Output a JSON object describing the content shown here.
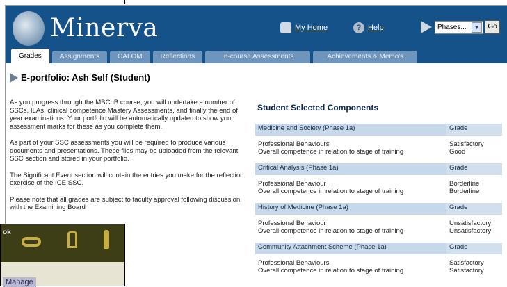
{
  "app": {
    "brand": "Minerva",
    "home_link": "My Home",
    "help_link": "Help",
    "help_glyph": "?",
    "phase_select_value": "Phases...",
    "phase_select_arrow": "▼",
    "go_label": "Go"
  },
  "tabs": [
    {
      "label": "Grades",
      "active": true
    },
    {
      "label": "Assignments",
      "active": false
    },
    {
      "label": "CALOM",
      "active": false
    },
    {
      "label": "Reflections",
      "active": false
    },
    {
      "label": "In-course Assessments",
      "active": false
    },
    {
      "label": "Achievements & Memo's",
      "active": false
    }
  ],
  "page": {
    "title": "E-portfolio: Ash Self (Student)",
    "intro": [
      "As you progress through the MBChB course, you will undertake a number of SSCs, ILAs, clinical competence Mastery Assessments, and finally the end of year examinations. Your portfolio will be automatically updated to show your assessment marks for these as you complete them.",
      "As part of your SSC assessments you will be required to produce various documents and presentations. These files may be uploaded from the relevant SSC section and stored in your portfolio.",
      "The Significant Event section will contain the entries you make for the reflection exercise of the ICE SSC.",
      "Please note that all grades are subject to faculty approval following discussion with the Examining Board"
    ]
  },
  "ssc": {
    "title": "Student Selected Components",
    "grade_header": "Grade",
    "components": [
      {
        "name": "Medicine and Society (Phase 1a)",
        "items": [
          "Professional Behaviours",
          "Overall competence in relation to stage of training"
        ],
        "grades": [
          "Satisfactory",
          "Good"
        ]
      },
      {
        "name": "Critical Analysis (Phase 1a)",
        "items": [
          "Professional Behaviour",
          "Overall competence in relation to stage of training"
        ],
        "grades": [
          "Borderline",
          "Borderline"
        ]
      },
      {
        "name": "History of Medicine (Phase 1a)",
        "items": [
          "Professional Behaviour",
          "Overall competence in relation to stage of training"
        ],
        "grades": [
          "Unsatisfactory",
          "Unsatisfactory"
        ]
      },
      {
        "name": "Community Attachment Scheme (Phase 1a)",
        "items": [
          "Professional Behaviours",
          "Overall competence in relation to stage of training"
        ],
        "grades": [
          "Satisfactory",
          "Satisfactory"
        ]
      }
    ]
  },
  "background_window": {
    "ok_text": "ok",
    "manage_label": "Manage"
  },
  "colors": {
    "header_bg": "#155289",
    "tab_bg": "#6d95bd",
    "row_header_bg": "#c6d8ea"
  }
}
